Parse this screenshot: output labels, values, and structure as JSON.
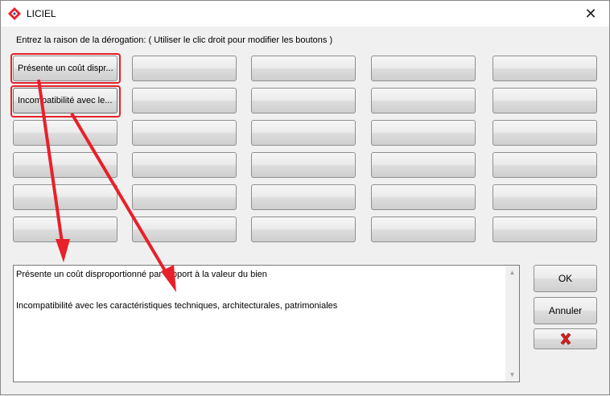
{
  "window": {
    "title": "LICIEL",
    "close_glyph": "✕"
  },
  "instruction": "Entrez la raison de la dérogation: ( Utiliser le clic droit pour modifier les boutons )",
  "reason_buttons": {
    "row1_col1": "Présente un coût dispr...",
    "row2_col1": "Incompatibilité avec le..."
  },
  "textarea": {
    "line1": "Présente un coût disproportionné par rapport à la valeur du bien",
    "line2": "Incompatibilité avec les caractéristiques techniques, architecturales, patrimoniales"
  },
  "actions": {
    "ok_label": "OK",
    "cancel_label": "Annuler",
    "delete_icon": "red-x-icon"
  },
  "colors": {
    "annotation_red": "#e8202a",
    "delete_red": "#d42020"
  }
}
